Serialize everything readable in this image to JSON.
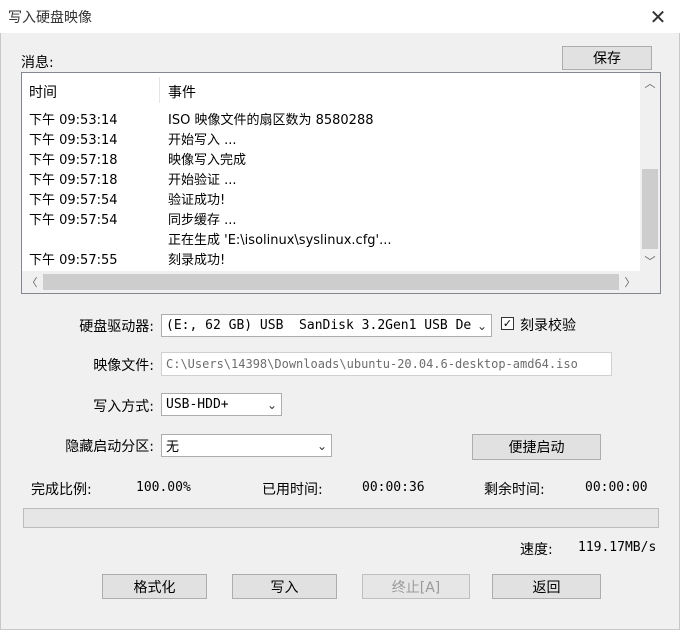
{
  "window": {
    "title": "写入硬盘映像"
  },
  "messages": {
    "label": "消息:",
    "save_label": "保存",
    "columns": [
      "时间",
      "事件"
    ],
    "rows": [
      {
        "time": "下午 09:53:14",
        "event": "ISO 映像文件的扇区数为 8580288"
      },
      {
        "time": "下午 09:53:14",
        "event": "开始写入 ..."
      },
      {
        "time": "下午 09:57:18",
        "event": "映像写入完成"
      },
      {
        "time": "下午 09:57:18",
        "event": "开始验证 ..."
      },
      {
        "time": "下午 09:57:54",
        "event": "验证成功!"
      },
      {
        "time": "下午 09:57:54",
        "event": "同步缓存 ..."
      },
      {
        "time": "",
        "event": "正在生成 'E:\\isolinux\\syslinux.cfg'..."
      },
      {
        "time": "下午 09:57:55",
        "event": "刻录成功!"
      }
    ]
  },
  "form": {
    "drive_label": "硬盘驱动器:",
    "drive_value": "(E:, 62 GB) USB  SanDisk 3.2Gen1 USB De",
    "verify_label": "刻录校验",
    "verify_checked": true,
    "image_label": "映像文件:",
    "image_value": "C:\\Users\\14398\\Downloads\\ubuntu-20.04.6-desktop-amd64.iso",
    "method_label": "写入方式:",
    "method_value": "USB-HDD+",
    "hidden_label": "隐藏启动分区:",
    "hidden_value": "无",
    "quickboot_label": "便捷启动"
  },
  "status": {
    "percent_label": "完成比例:",
    "percent_value": "100.00%",
    "progress_fraction": 1.0,
    "elapsed_label": "已用时间:",
    "elapsed_value": "00:00:36",
    "remaining_label": "剩余时间:",
    "remaining_value": "00:00:00",
    "speed_label": "速度:",
    "speed_value": "119.17MB/s"
  },
  "buttons": {
    "format": "格式化",
    "write": "写入",
    "stop": "终止[A]",
    "back": "返回"
  }
}
